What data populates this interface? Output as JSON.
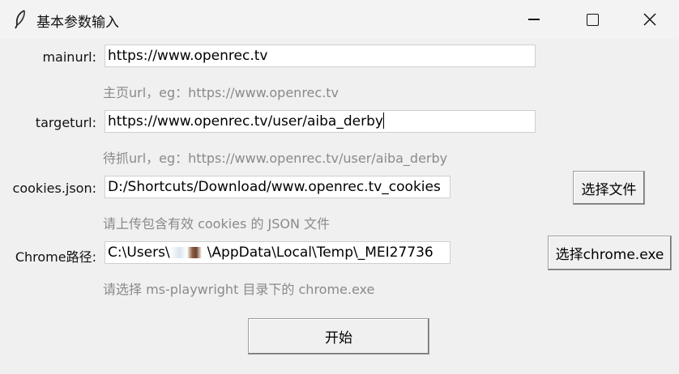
{
  "window": {
    "title": "基本参数输入"
  },
  "fields": {
    "mainurl": {
      "label": "mainurl:",
      "value": "https://www.openrec.tv",
      "hint": "主页url，eg：https://www.openrec.tv"
    },
    "targeturl": {
      "label": "targeturl:",
      "value": "https://www.openrec.tv/user/aiba_derby",
      "hint": "待抓url，eg：https://www.openrec.tv/user/aiba_derby"
    },
    "cookies": {
      "label": "cookies.json:",
      "value": "D:/Shortcuts/Download/www.openrec.tv_cookies",
      "hint": "请上传包含有效 cookies 的 JSON 文件",
      "button": "选择文件"
    },
    "chrome": {
      "label": "Chrome路径:",
      "value_prefix": "C:\\Users\\",
      "value_suffix": "\\AppData\\Local\\Temp\\_MEI27736",
      "hint": "请选择 ms-playwright 目录下的 chrome.exe",
      "button": "选择chrome.exe"
    }
  },
  "start_button": "开始",
  "icons": {
    "app": "feather-icon",
    "minimize": "minimize-icon",
    "maximize": "maximize-icon",
    "close": "close-icon"
  }
}
